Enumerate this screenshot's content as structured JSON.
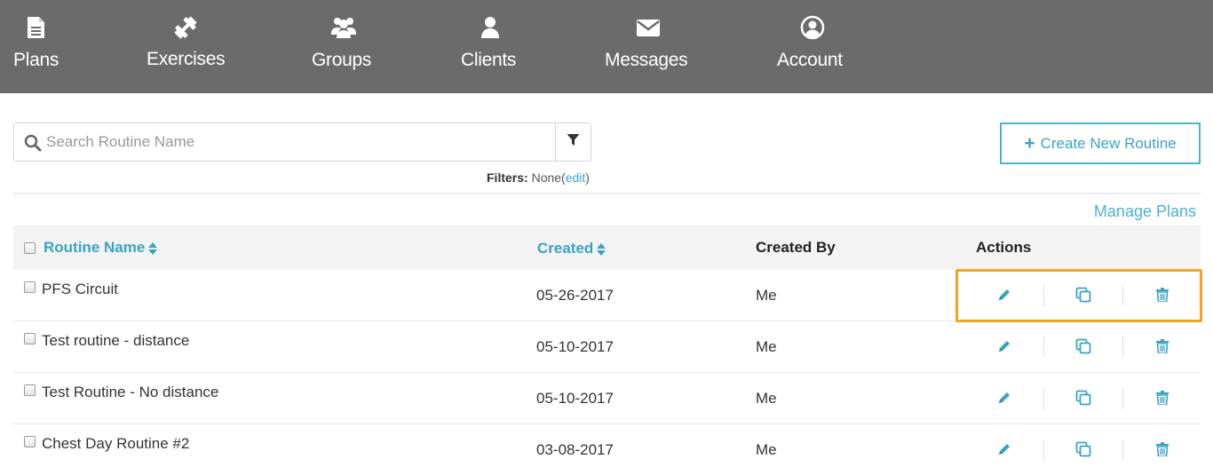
{
  "nav": {
    "items": [
      {
        "label": "Plans",
        "icon": "document-icon"
      },
      {
        "label": "Exercises",
        "icon": "dumbbell-icon"
      },
      {
        "label": "Groups",
        "icon": "group-icon"
      },
      {
        "label": "Clients",
        "icon": "user-icon"
      },
      {
        "label": "Messages",
        "icon": "envelope-icon"
      },
      {
        "label": "Account",
        "icon": "user-circle-icon"
      }
    ]
  },
  "search": {
    "placeholder": "Search Routine Name",
    "value": ""
  },
  "filters": {
    "label": "Filters:",
    "value": "None",
    "open_paren": "(",
    "edit_label": "edit",
    "close_paren": ")"
  },
  "create_button": {
    "icon": "plus",
    "label": "Create New Routine"
  },
  "manage_plans_label": "Manage Plans",
  "table": {
    "headers": {
      "name": "Routine Name",
      "created": "Created",
      "created_by": "Created By",
      "actions": "Actions"
    },
    "rows": [
      {
        "name": "PFS Circuit",
        "created": "05-26-2017",
        "created_by": "Me"
      },
      {
        "name": "Test routine - distance",
        "created": "05-10-2017",
        "created_by": "Me"
      },
      {
        "name": "Test Routine - No distance",
        "created": "05-10-2017",
        "created_by": "Me"
      },
      {
        "name": "Chest Day Routine #2",
        "created": "03-08-2017",
        "created_by": "Me"
      }
    ],
    "action_icons": [
      "pencil-icon",
      "copy-icon",
      "trash-icon"
    ]
  },
  "colors": {
    "nav_bg": "#6b6b6b",
    "accent": "#3aa3c4",
    "highlight": "#f0a423"
  }
}
